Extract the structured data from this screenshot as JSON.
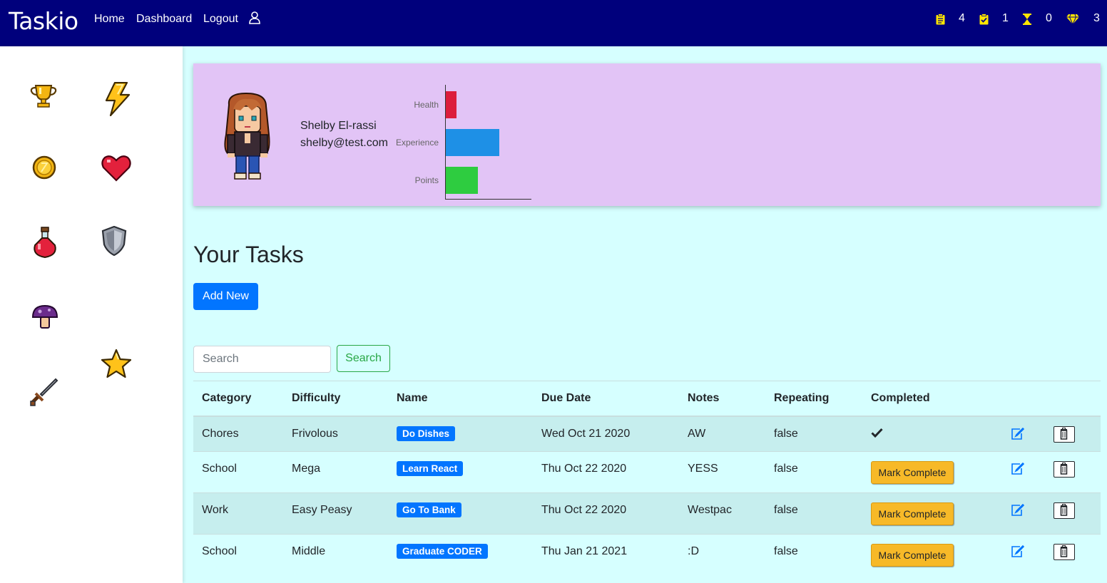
{
  "app": {
    "brand": "Taskio"
  },
  "nav": {
    "home": "Home",
    "dashboard": "Dashboard",
    "logout": "Logout",
    "user_icon": "user-icon"
  },
  "stats": [
    {
      "icon": "clipboard-icon",
      "value": "4",
      "color": "#ffe600"
    },
    {
      "icon": "clipboard-check-icon",
      "value": "1",
      "color": "#ffe600"
    },
    {
      "icon": "hourglass-icon",
      "value": "0",
      "color": "#ffe600"
    },
    {
      "icon": "gem-icon",
      "value": "3",
      "color": "#ffe600"
    }
  ],
  "sidebar": {
    "icons": [
      "trophy-icon",
      "lightning-icon",
      "coin-icon",
      "heart-icon",
      "potion-icon",
      "shield-icon",
      "mushroom-icon",
      "star-icon",
      "sword-icon"
    ]
  },
  "profile": {
    "name": "Shelby El-rassi",
    "email": "shelby@test.com",
    "avatar": "pixel-avatar"
  },
  "chart_data": {
    "type": "bar",
    "orientation": "horizontal",
    "categories": [
      "Health",
      "Experience",
      "Points"
    ],
    "values": [
      15,
      75,
      45
    ],
    "colors": [
      "#dc1d3c",
      "#1e90e6",
      "#2ecc40"
    ],
    "xlim": [
      0,
      120
    ],
    "grid": false
  },
  "tasks_section": {
    "heading": "Your Tasks",
    "add_label": "Add New",
    "search_placeholder": "Search",
    "search_label": "Search"
  },
  "table": {
    "headers": [
      "Category",
      "Difficulty",
      "Name",
      "Due Date",
      "Notes",
      "Repeating",
      "Completed"
    ],
    "rows": [
      {
        "category": "Chores",
        "difficulty": "Frivolous",
        "name": "Do Dishes",
        "due": "Wed Oct 21 2020",
        "notes": "AW",
        "repeating": "false",
        "completed": true
      },
      {
        "category": "School",
        "difficulty": "Mega",
        "name": "Learn React",
        "due": "Thu Oct 22 2020",
        "notes": "YESS",
        "repeating": "false",
        "completed": false
      },
      {
        "category": "Work",
        "difficulty": "Easy Peasy",
        "name": "Go To Bank",
        "due": "Thu Oct 22 2020",
        "notes": "Westpac",
        "repeating": "false",
        "completed": false
      },
      {
        "category": "School",
        "difficulty": "Middle",
        "name": "Graduate CODER",
        "due": "Thu Jan 21 2021",
        "notes": ":D",
        "repeating": "false",
        "completed": false
      }
    ],
    "mark_complete_label": "Mark Complete"
  }
}
